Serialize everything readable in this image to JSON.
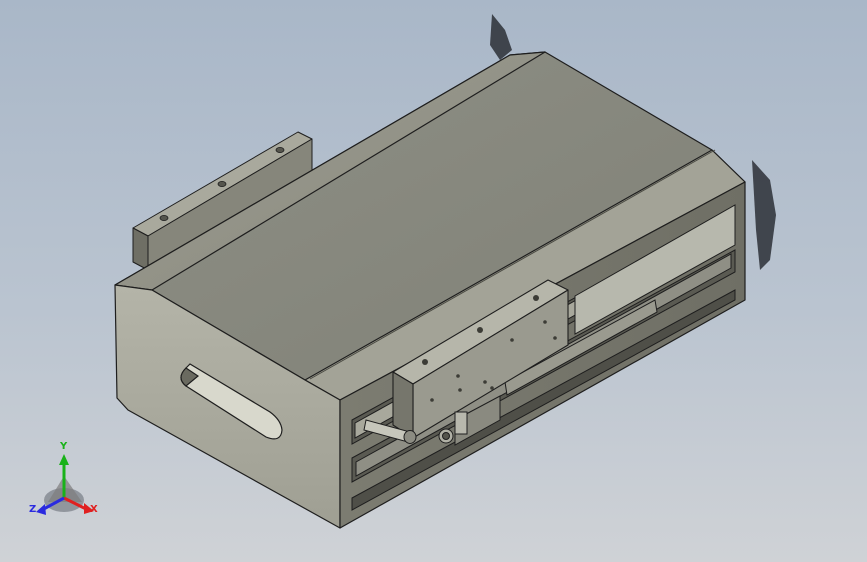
{
  "viewport": {
    "background_top": "#a9b7c8",
    "background_bottom": "#cfd2d6"
  },
  "model": {
    "face_light": "#aaaa9e",
    "face_mid": "#8d8e84",
    "face_dark": "#7b7b70",
    "edge": "#1e1e1e"
  },
  "triad": {
    "x_label": "X",
    "y_label": "Y",
    "z_label": "Z",
    "x_color": "#e02020",
    "y_color": "#19b219",
    "z_color": "#2a2ae0",
    "icon": "axis-triad-icon"
  }
}
